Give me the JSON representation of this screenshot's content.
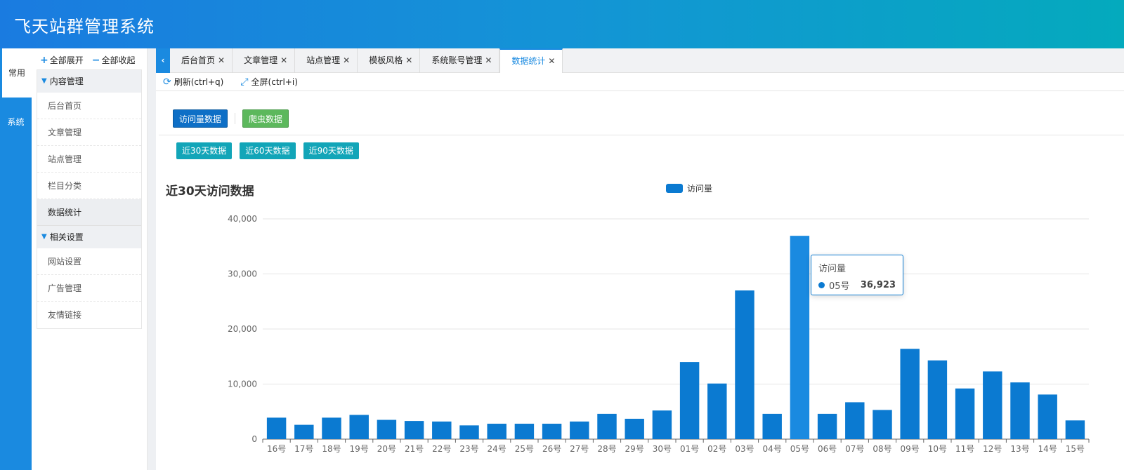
{
  "app": {
    "title": "飞天站群管理系统"
  },
  "vertical_tabs": {
    "common": "常用",
    "system": "系统"
  },
  "sidebar": {
    "expand_all": "全部展开",
    "collapse_all": "全部收起",
    "groups": [
      {
        "label": "内容管理",
        "items": [
          "后台首页",
          "文章管理",
          "站点管理",
          "栏目分类",
          "数据统计"
        ]
      },
      {
        "label": "相关设置",
        "items": [
          "网站设置",
          "广告管理",
          "友情链接"
        ]
      }
    ],
    "active_item": "数据统计"
  },
  "tabs": [
    "后台首页",
    "文章管理",
    "站点管理",
    "模板风格",
    "系统账号管理",
    "数据统计"
  ],
  "active_tab": "数据统计",
  "toolbar": {
    "refresh": "刷新(ctrl+q)",
    "fullscreen": "全屏(ctrl+i)"
  },
  "buttons": {
    "visits_data": "访问量数据",
    "crawler_data": "爬虫数据",
    "range_30": "近30天数据",
    "range_60": "近60天数据",
    "range_90": "近90天数据"
  },
  "colors": {
    "accent": "#1a8ae0",
    "bar": "#0b7ad1",
    "bar_highlight": "#1a8ae0"
  },
  "chart_data": {
    "type": "bar",
    "title": "近30天访问数据",
    "legend_position": "top-center",
    "grid": true,
    "series": [
      {
        "name": "访问量",
        "values": [
          3900,
          2600,
          3900,
          4400,
          3500,
          3300,
          3200,
          2500,
          2800,
          2800,
          2800,
          3200,
          4600,
          3700,
          5200,
          14000,
          10100,
          27000,
          4600,
          36923,
          4600,
          6700,
          5300,
          16400,
          14300,
          9200,
          12300,
          10300,
          8100,
          3400
        ]
      }
    ],
    "categories": [
      "16号",
      "17号",
      "18号",
      "19号",
      "20号",
      "21号",
      "22号",
      "23号",
      "24号",
      "25号",
      "26号",
      "27号",
      "28号",
      "29号",
      "30号",
      "01号",
      "02号",
      "03号",
      "04号",
      "05号",
      "06号",
      "07号",
      "08号",
      "09号",
      "10号",
      "11号",
      "12号",
      "13号",
      "14号",
      "15号"
    ],
    "ylim": [
      0,
      40000
    ],
    "yticks": [
      "0",
      "10,000",
      "20,000",
      "30,000",
      "40,000"
    ],
    "tooltip": {
      "series": "访问量",
      "category": "05号",
      "value": "36,923"
    }
  }
}
